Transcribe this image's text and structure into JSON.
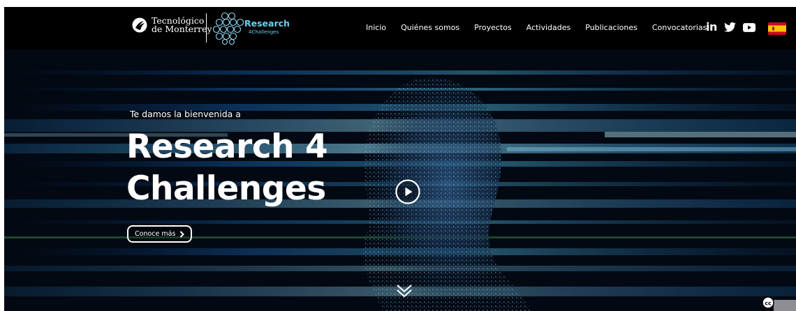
{
  "brand": {
    "tec_line1": "Tecnológico",
    "tec_line2": "de Monterrey",
    "r4c_title": "Research",
    "r4c_sub": "4Challenges"
  },
  "nav": {
    "items": [
      {
        "label": "Inicio"
      },
      {
        "label": "Quiénes somos"
      },
      {
        "label": "Proyectos"
      },
      {
        "label": "Actividades"
      },
      {
        "label": "Publicaciones"
      },
      {
        "label": "Convocatorias"
      }
    ]
  },
  "social": {
    "icons": [
      "linkedin-icon",
      "twitter-icon",
      "youtube-icon"
    ],
    "linkedin_label": "in"
  },
  "language": {
    "flag": "spain-flag-icon"
  },
  "hero": {
    "welcome": "Te damos la bienvenida a",
    "title_line1": "Research 4",
    "title_line2": "Challenges",
    "cta_label": "Conoce más",
    "cta_icon": "chevron-right-icon",
    "play_icon": "play-icon",
    "scroll_icon": "double-chevron-down-icon"
  },
  "colors": {
    "brand_cyan": "#6ad0f2",
    "background": "#000000",
    "text": "#ffffff",
    "flag_red": "#c60b1e",
    "flag_yellow": "#ffc400"
  },
  "footer": {
    "cc_icon": "creative-commons-icon",
    "cc_label": "cc"
  }
}
